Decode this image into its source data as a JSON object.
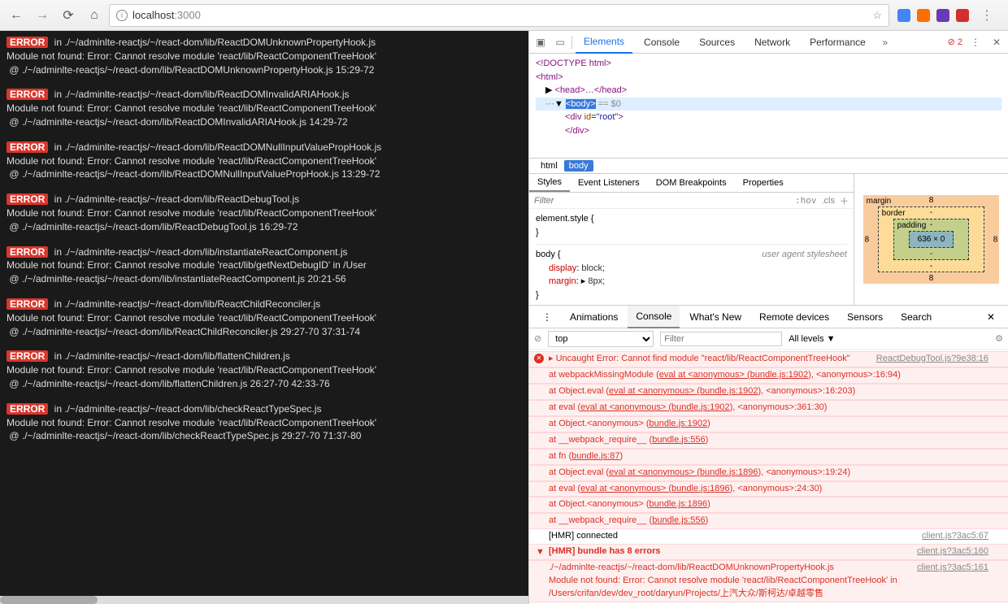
{
  "browser": {
    "url_host": "localhost",
    "url_port": ":3000",
    "ext_colors": [
      "#4285f4",
      "#ff6d00",
      "#673ab7",
      "#d32f2f"
    ]
  },
  "errors": [
    {
      "file": "./~/adminlte-reactjs/~/react-dom/lib/ReactDOMUnknownPropertyHook.js",
      "msg": "Module not found: Error: Cannot resolve module 'react/lib/ReactComponentTreeHook'",
      "at": "@ ./~/adminlte-reactjs/~/react-dom/lib/ReactDOMUnknownPropertyHook.js 15:29-72"
    },
    {
      "file": "./~/adminlte-reactjs/~/react-dom/lib/ReactDOMInvalidARIAHook.js",
      "msg": "Module not found: Error: Cannot resolve module 'react/lib/ReactComponentTreeHook'",
      "at": "@ ./~/adminlte-reactjs/~/react-dom/lib/ReactDOMInvalidARIAHook.js 14:29-72"
    },
    {
      "file": "./~/adminlte-reactjs/~/react-dom/lib/ReactDOMNullInputValuePropHook.js",
      "msg": "Module not found: Error: Cannot resolve module 'react/lib/ReactComponentTreeHook'",
      "at": "@ ./~/adminlte-reactjs/~/react-dom/lib/ReactDOMNullInputValuePropHook.js 13:29-72"
    },
    {
      "file": "./~/adminlte-reactjs/~/react-dom/lib/ReactDebugTool.js",
      "msg": "Module not found: Error: Cannot resolve module 'react/lib/ReactComponentTreeHook'",
      "at": "@ ./~/adminlte-reactjs/~/react-dom/lib/ReactDebugTool.js 16:29-72"
    },
    {
      "file": "./~/adminlte-reactjs/~/react-dom/lib/instantiateReactComponent.js",
      "msg": "Module not found: Error: Cannot resolve module 'react/lib/getNextDebugID' in /User",
      "at": "@ ./~/adminlte-reactjs/~/react-dom/lib/instantiateReactComponent.js 20:21-56"
    },
    {
      "file": "./~/adminlte-reactjs/~/react-dom/lib/ReactChildReconciler.js",
      "msg": "Module not found: Error: Cannot resolve module 'react/lib/ReactComponentTreeHook'",
      "at": "@ ./~/adminlte-reactjs/~/react-dom/lib/ReactChildReconciler.js 29:27-70 37:31-74"
    },
    {
      "file": "./~/adminlte-reactjs/~/react-dom/lib/flattenChildren.js",
      "msg": "Module not found: Error: Cannot resolve module 'react/lib/ReactComponentTreeHook'",
      "at": "@ ./~/adminlte-reactjs/~/react-dom/lib/flattenChildren.js 26:27-70 42:33-76"
    },
    {
      "file": "./~/adminlte-reactjs/~/react-dom/lib/checkReactTypeSpec.js",
      "msg": "Module not found: Error: Cannot resolve module 'react/lib/ReactComponentTreeHook'",
      "at": "@ ./~/adminlte-reactjs/~/react-dom/lib/checkReactTypeSpec.js 29:27-70 71:37-80"
    }
  ],
  "devtools": {
    "tabs": [
      "Elements",
      "Console",
      "Sources",
      "Network",
      "Performance"
    ],
    "err_count": "2",
    "dom": {
      "doctype": "<!DOCTYPE html>",
      "html_open": "<html>",
      "head": "<head>…</head>",
      "body_open": "<body>",
      "eq0": " == $0",
      "div": "<div id=\"root\">",
      "div_close": "</div>"
    },
    "crumbs": [
      "html",
      "body"
    ],
    "styles_tabs": [
      "Styles",
      "Event Listeners",
      "DOM Breakpoints",
      "Properties"
    ],
    "filter_placeholder": "Filter",
    "hov_label": ":hov",
    "cls_label": ".cls",
    "element_style": "element.style {",
    "body_rule": "body {",
    "uas": "user agent stylesheet",
    "display_prop": "display",
    "display_val": "block;",
    "margin_prop": "margin",
    "margin_val": "8px;",
    "box": {
      "margin": "margin",
      "margin_v": "8",
      "border": "border",
      "border_v": "-",
      "padding": "padding",
      "padding_v": "-",
      "content": "636 × 0"
    }
  },
  "drawer": {
    "tabs": [
      "Animations",
      "Console",
      "What's New",
      "Remote devices",
      "Sensors",
      "Search"
    ],
    "context": "top",
    "filter_placeholder": "Filter",
    "levels": "All levels ▼",
    "console": {
      "uncaught_src": "ReactDebugTool.js?9e38:16",
      "uncaught": "Uncaught Error: Cannot find module \"react/lib/ReactComponentTreeHook\"",
      "stack": [
        "    at webpackMissingModule (eval at <anonymous> (bundle.js:1902), <anonymous>:16:94)",
        "    at Object.eval (eval at <anonymous> (bundle.js:1902), <anonymous>:16:203)",
        "    at eval (eval at <anonymous> (bundle.js:1902), <anonymous>:361:30)",
        "    at Object.<anonymous> (bundle.js:1902)",
        "    at __webpack_require__ (bundle.js:556)",
        "    at fn (bundle.js:87)",
        "    at Object.eval (eval at <anonymous> (bundle.js:1896), <anonymous>:19:24)",
        "    at eval (eval at <anonymous> (bundle.js:1896), <anonymous>:24:30)",
        "    at Object.<anonymous> (bundle.js:1896)",
        "    at __webpack_require__ (bundle.js:556)"
      ],
      "hmr_connected": "[HMR] connected",
      "hmr_connected_src": "client.js?3ac5:67",
      "hmr_errors": "[HMR] bundle has 8 errors",
      "hmr_errors_src": "client.js?3ac5:160",
      "hmr_detail_src": "client.js?3ac5:161",
      "hmr_detail": "./~/adminlte-reactjs/~/react-dom/lib/ReactDOMUnknownPropertyHook.js\nModule not found: Error: Cannot resolve module 'react/lib/ReactComponentTreeHook' in /Users/crifan/dev/dev_root/daryun/Projects/上汽大众/斯柯达/卓越零售"
    }
  },
  "error_label": "ERROR",
  "in_label": " in "
}
